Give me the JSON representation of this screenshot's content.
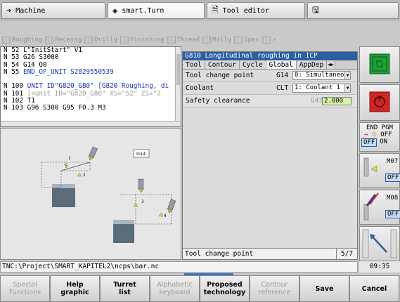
{
  "tabs": [
    {
      "label": "Machine",
      "icon": "arrow-right-icon"
    },
    {
      "label": "smart.Turn",
      "icon": "diamond-arrow-icon"
    },
    {
      "label": "Tool editor",
      "icon": "document-icon"
    },
    {
      "label": "",
      "icon": "save-disk-icon"
    }
  ],
  "cycle_groups": [
    "Roughing",
    "Recessg",
    "Drillg",
    "Finishing",
    "Thread",
    "Millg",
    "Spec",
    "↗"
  ],
  "program_lines": [
    {
      "n": "N  52",
      "text": "   L\"InitStart\" V1",
      "style": "normal"
    },
    {
      "n": "N  53",
      "text": "   G26 S3000",
      "style": "normal"
    },
    {
      "n": "N  54",
      "text": "   G14 Q0",
      "style": "normal"
    },
    {
      "n": "N  55",
      "text": " END_OF_UNIT S2829550539",
      "style": "mixed"
    },
    {
      "n": "",
      "text": "",
      "style": "normal"
    },
    {
      "n": "N 100",
      "text": " UNIT ID\"G820_G80\" [G820 Roughing, di",
      "style": "unit"
    },
    {
      "n": "N 101",
      "text": "   [<unit ID=\"G820_G80\" XS=\"52\" ZS=\"2",
      "style": "gray"
    },
    {
      "n": "N 102",
      "text": "   T1",
      "style": "normal"
    },
    {
      "n": "N 103",
      "text": "   G96 S300 G95 F0.3 M3",
      "style": "normal"
    }
  ],
  "graphic": {
    "label": "G14",
    "arrow_labels": [
      "1",
      "2",
      "3",
      "4"
    ]
  },
  "dialog": {
    "title": "G810 Longitudinal roughing in ICP",
    "tabs": [
      "Tool",
      "Contour",
      "Cycle",
      "Global",
      "AppDep"
    ],
    "active_tab": "Global",
    "rows": [
      {
        "label": "Tool change point",
        "gcode": "G14",
        "value": "0: Simultaneou"
      },
      {
        "label": "Coolant",
        "gcode": "CLT",
        "value": "1: Coolant 1 c"
      },
      {
        "label": "Safety clearance",
        "gcode": "G47",
        "value": "2.000"
      }
    ],
    "status_text": "Tool change point",
    "page": "5/7"
  },
  "side_panel": {
    "end_pgm": "END PGM",
    "off": "OFF",
    "on": "ON",
    "ofl": "OFF",
    "m07": "M07",
    "m08": "M08"
  },
  "path": "TNC:\\Project\\SMART_KAPITEL2\\ncps\\bar.nc",
  "clock": "09:35",
  "softkeys": [
    {
      "label": "Special\nFunctions",
      "enabled": false
    },
    {
      "label": "Help\ngraphic",
      "enabled": true
    },
    {
      "label": "Turret\nlist",
      "enabled": true
    },
    {
      "label": "Alphabetic\nkeyboard",
      "enabled": false
    },
    {
      "label": "Proposed\ntechnology",
      "enabled": true
    },
    {
      "label": "Contour\nreference",
      "enabled": false
    },
    {
      "label": "Save",
      "enabled": true
    },
    {
      "label": "Cancel",
      "enabled": true
    }
  ],
  "colors": {
    "accent": "#2a5fa0",
    "value_bg": "#d6f5a8",
    "nc_green": "#1e9e3a",
    "nc_red": "#d32424"
  }
}
